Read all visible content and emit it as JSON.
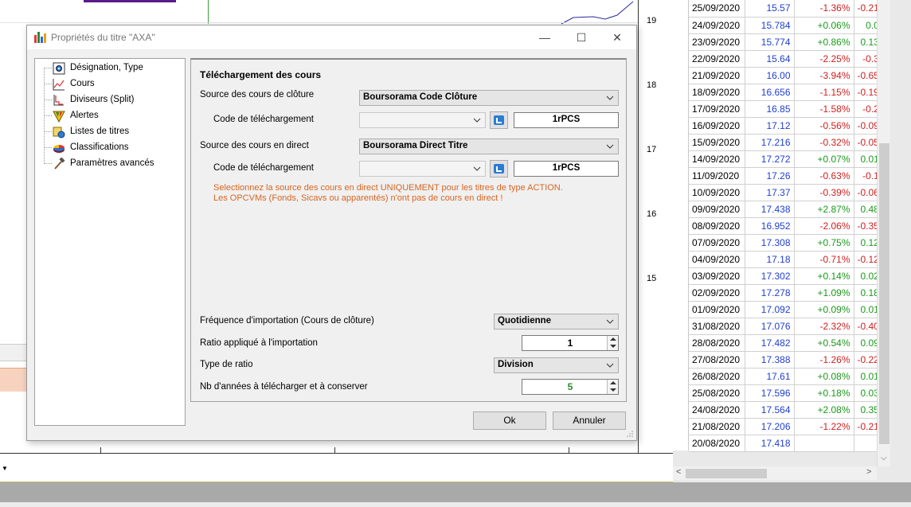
{
  "background": {
    "price_ticks": [
      "19",
      "18",
      "17",
      "16",
      "15"
    ]
  },
  "grid": {
    "rows": [
      {
        "date": "25/09/2020",
        "price": "15.57",
        "pct": "-1.36%",
        "var": "-0.21",
        "dir": "neg"
      },
      {
        "date": "24/09/2020",
        "price": "15.784",
        "pct": "+0.06%",
        "var": "0.0",
        "dir": "pos"
      },
      {
        "date": "23/09/2020",
        "price": "15.774",
        "pct": "+0.86%",
        "var": "0.13",
        "dir": "pos"
      },
      {
        "date": "22/09/2020",
        "price": "15.64",
        "pct": "-2.25%",
        "var": "-0.3",
        "dir": "neg"
      },
      {
        "date": "21/09/2020",
        "price": "16.00",
        "pct": "-3.94%",
        "var": "-0.65",
        "dir": "neg"
      },
      {
        "date": "18/09/2020",
        "price": "16.656",
        "pct": "-1.15%",
        "var": "-0.19",
        "dir": "neg"
      },
      {
        "date": "17/09/2020",
        "price": "16.85",
        "pct": "-1.58%",
        "var": "-0.2",
        "dir": "neg"
      },
      {
        "date": "16/09/2020",
        "price": "17.12",
        "pct": "-0.56%",
        "var": "-0.09",
        "dir": "neg"
      },
      {
        "date": "15/09/2020",
        "price": "17.216",
        "pct": "-0.32%",
        "var": "-0.05",
        "dir": "neg"
      },
      {
        "date": "14/09/2020",
        "price": "17.272",
        "pct": "+0.07%",
        "var": "0.01",
        "dir": "pos"
      },
      {
        "date": "11/09/2020",
        "price": "17.26",
        "pct": "-0.63%",
        "var": "-0.1",
        "dir": "neg"
      },
      {
        "date": "10/09/2020",
        "price": "17.37",
        "pct": "-0.39%",
        "var": "-0.06",
        "dir": "neg"
      },
      {
        "date": "09/09/2020",
        "price": "17.438",
        "pct": "+2.87%",
        "var": "0.48",
        "dir": "pos"
      },
      {
        "date": "08/09/2020",
        "price": "16.952",
        "pct": "-2.06%",
        "var": "-0.35",
        "dir": "neg"
      },
      {
        "date": "07/09/2020",
        "price": "17.308",
        "pct": "+0.75%",
        "var": "0.12",
        "dir": "pos"
      },
      {
        "date": "04/09/2020",
        "price": "17.18",
        "pct": "-0.71%",
        "var": "-0.12",
        "dir": "neg"
      },
      {
        "date": "03/09/2020",
        "price": "17.302",
        "pct": "+0.14%",
        "var": "0.02",
        "dir": "pos"
      },
      {
        "date": "02/09/2020",
        "price": "17.278",
        "pct": "+1.09%",
        "var": "0.18",
        "dir": "pos"
      },
      {
        "date": "01/09/2020",
        "price": "17.092",
        "pct": "+0.09%",
        "var": "0.01",
        "dir": "pos"
      },
      {
        "date": "31/08/2020",
        "price": "17.076",
        "pct": "-2.32%",
        "var": "-0.40",
        "dir": "neg"
      },
      {
        "date": "28/08/2020",
        "price": "17.482",
        "pct": "+0.54%",
        "var": "0.09",
        "dir": "pos"
      },
      {
        "date": "27/08/2020",
        "price": "17.388",
        "pct": "-1.26%",
        "var": "-0.22",
        "dir": "neg"
      },
      {
        "date": "26/08/2020",
        "price": "17.61",
        "pct": "+0.08%",
        "var": "0.01",
        "dir": "pos"
      },
      {
        "date": "25/08/2020",
        "price": "17.596",
        "pct": "+0.18%",
        "var": "0.03",
        "dir": "pos"
      },
      {
        "date": "24/08/2020",
        "price": "17.564",
        "pct": "+2.08%",
        "var": "0.35",
        "dir": "pos"
      },
      {
        "date": "21/08/2020",
        "price": "17.206",
        "pct": "-1.22%",
        "var": "-0.21",
        "dir": "neg"
      },
      {
        "date": "20/08/2020",
        "price": "17.418",
        "pct": "",
        "var": "",
        "dir": "none"
      }
    ]
  },
  "dialog": {
    "title": "Propriétés du titre \"AXA\"",
    "window_buttons": {
      "minimize": "—",
      "maximize": "☐",
      "close": "✕"
    },
    "tree": [
      {
        "label": "Désignation, Type",
        "icon": "gear-doc-icon"
      },
      {
        "label": "Cours",
        "icon": "line-chart-icon"
      },
      {
        "label": "Diviseurs (Split)",
        "icon": "split-icon"
      },
      {
        "label": "Alertes",
        "icon": "alert-funnel-icon"
      },
      {
        "label": "Listes de titres",
        "icon": "list-globe-icon"
      },
      {
        "label": "Classifications",
        "icon": "pie-chart-icon"
      },
      {
        "label": "Paramètres avancés",
        "icon": "tools-icon"
      }
    ],
    "content": {
      "section_title": "Téléchargement des cours",
      "close_source_label": "Source des cours de clôture",
      "close_source_value": "Boursorama Code Clôture",
      "download_code_label_1": "Code de téléchargement",
      "download_code_1": "1rPCS",
      "live_source_label": "Source des cours en direct",
      "live_source_value": "Boursorama Direct Titre",
      "download_code_label_2": "Code de téléchargement",
      "download_code_2": "1rPCS",
      "warning_line_1": "Selectionnez la source des cours en direct UNIQUEMENT pour les titres de type ACTION.",
      "warning_line_2": "Les OPCVMs (Fonds, Sicavs ou apparentés) n'ont pas de cours en direct !",
      "frequency_label": "Fréquence d'importation (Cours de clôture)",
      "frequency_value": "Quotidienne",
      "ratio_label": "Ratio appliqué à l'importation",
      "ratio_value": "1",
      "ratio_type_label": "Type de ratio",
      "ratio_type_value": "Division",
      "years_label": "Nb d'années à télécharger et à conserver",
      "years_value": "5"
    },
    "ok_label": "Ok",
    "cancel_label": "Annuler"
  }
}
